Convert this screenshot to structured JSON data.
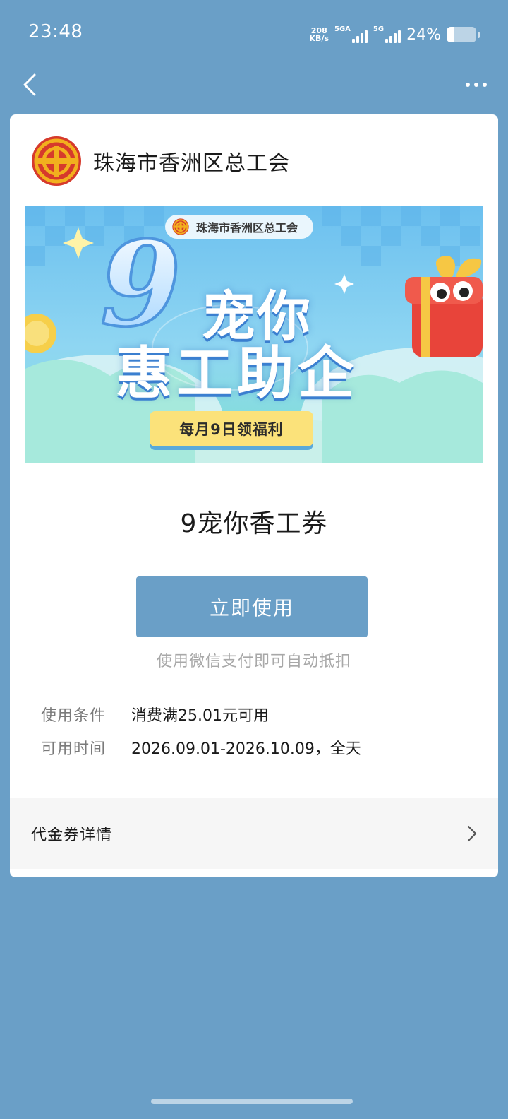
{
  "status_bar": {
    "time": "23:48",
    "net_speed_value": "208",
    "net_speed_unit": "KB/s",
    "sim1_label": "5GA",
    "sim2_label": "5G",
    "battery_percent": "24%",
    "battery_level": 0.24
  },
  "nav": {
    "back_icon": "chevron-left-icon",
    "more_icon": "more-horizontal-icon"
  },
  "merchant": {
    "name": "珠海市香洲区总工会"
  },
  "banner": {
    "badge_text": "珠海市香洲区总工会",
    "big_number": "9",
    "headline_line1": "宠你",
    "headline_line2": "惠工助企",
    "pill_text": "每月9日领福利"
  },
  "coupon": {
    "title": "9宠你香工券",
    "use_button_label": "立即使用",
    "use_hint": "使用微信支付即可自动抵扣",
    "conditions_label": "使用条件",
    "conditions_value": "消费满25.01元可用",
    "time_label": "可用时间",
    "time_value": "2026.09.01-2026.10.09，全天",
    "details_label": "代金券详情"
  },
  "colors": {
    "background": "#6a9fc7",
    "button": "#6a9fc7",
    "card": "#ffffff",
    "logo_red": "#d63a2c",
    "logo_gold": "#f2b01e"
  }
}
